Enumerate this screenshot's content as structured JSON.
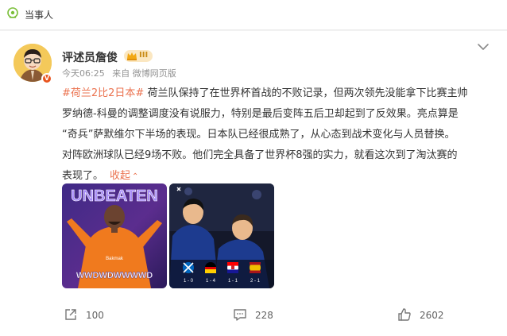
{
  "topbar": {
    "label": "当事人"
  },
  "post": {
    "author": "评述员詹俊",
    "rank_level": "III",
    "meta": {
      "time": "今天06:25",
      "source": "来自 微博网页版"
    },
    "body_lines": [
      {
        "tag": "#荷兰2比2日本#",
        "text": " 荷兰队保持了在世界杯首战的不败记录，但两次领先没能拿下比赛主帅"
      },
      {
        "text": "罗纳德-科曼的调整调度没有说服力，特别是最后变阵五后卫却起到了反效果。亮点算是"
      },
      {
        "text": "“奇兵”萨默维尔下半场的表现。日本队已经很成熟了，从心态到战术变化与人员替换。"
      },
      {
        "text": "对阵欧洲球队已经9场不败。他们完全具备了世界杯8强的实力，就看这次到了淘汰赛的"
      },
      {
        "text": "表现了。"
      }
    ],
    "collapse_label": "收起",
    "images": {
      "first": {
        "headline": "UNBEATEN",
        "record": "WWDWDWWWWD",
        "watermark": "Bakmak"
      },
      "second": {
        "results": [
          {
            "score": "1 - 0"
          },
          {
            "score": "1 - 4"
          },
          {
            "score": "1 - 1"
          },
          {
            "score": "2 - 1"
          }
        ]
      }
    },
    "actions": {
      "share_count": "100",
      "comment_count": "228",
      "like_count": "2602"
    }
  }
}
